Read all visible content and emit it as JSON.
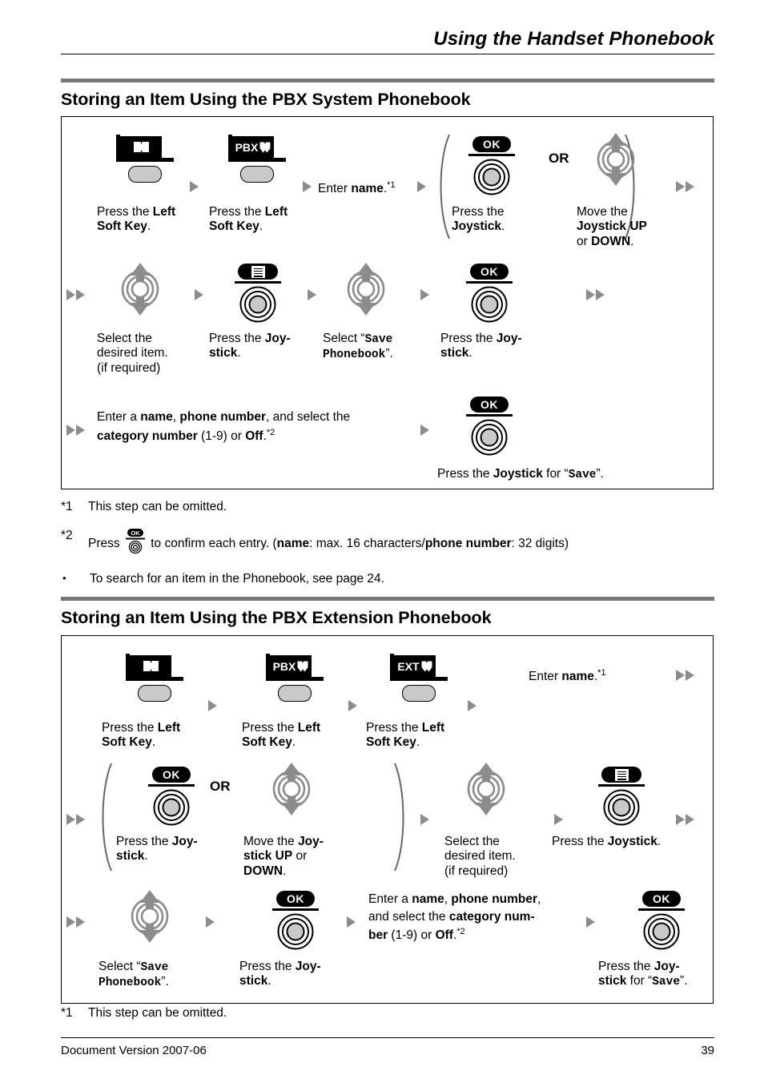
{
  "header": {
    "title": "Using the Handset Phonebook"
  },
  "section1": {
    "heading": "Storing an Item Using the PBX System Phonebook",
    "row1": {
      "step1": {
        "icon": "phonebook-softkey-icon",
        "badge": "",
        "caption_pre": "Press the ",
        "caption_bold": "Left Soft Key",
        "caption_post": "."
      },
      "step2": {
        "icon": "pbx-softkey-icon",
        "badge": "PBX",
        "caption_pre": "Press the ",
        "caption_bold": "Left Soft Key",
        "caption_post": "."
      },
      "step3": {
        "text_pre": "Enter ",
        "text_bold": "name",
        "text_post": ".",
        "footnote": "*1"
      },
      "step4": {
        "icon": "joystick-ok-icon",
        "label": "OK",
        "caption_pre": "Press the ",
        "caption_bold": "Joystick",
        "caption_post": "."
      },
      "or_label": "OR",
      "step5": {
        "icon": "joystick-updown-icon",
        "caption_l1_pre": "Move the ",
        "caption_l1_bold": "Joystick UP",
        "caption_l2_pre": "or ",
        "caption_l2_bold": "DOWN",
        "caption_l2_post": "."
      }
    },
    "row2": {
      "step6": {
        "icon": "joystick-updown-icon",
        "caption_l1": "Select the",
        "caption_l2": "desired item.",
        "caption_l3": "(if required)"
      },
      "step7": {
        "icon": "joystick-menu-icon",
        "label": "menu-glyph",
        "caption_pre": "Press the ",
        "caption_bold": "Joy-stick",
        "caption_post": "."
      },
      "step8": {
        "icon": "joystick-updown-icon",
        "caption_pre": "Select “",
        "caption_mono": "Save Phonebook",
        "caption_post": "”."
      },
      "step9": {
        "icon": "joystick-ok-icon",
        "label": "OK",
        "caption_pre": "Press the ",
        "caption_bold": "Joy-stick",
        "caption_post": "."
      }
    },
    "row3": {
      "step10": {
        "l1_pre": "Enter a ",
        "l1_b1": "name",
        "l1_mid": ", ",
        "l1_b2": "phone number",
        "l1_post": ", and select the",
        "l2_b1": "category number",
        "l2_mid": " (1-9) or ",
        "l2_b2": "Off",
        "l2_post": ".",
        "footnote": "*2"
      },
      "step11": {
        "icon": "joystick-ok-icon",
        "label": "OK",
        "caption_pre": "Press the ",
        "caption_bold": "Joystick",
        "caption_mid": " for “",
        "caption_mono": "Save",
        "caption_post": "”."
      }
    },
    "footnotes": [
      {
        "mark": "*1",
        "text": "This step can be omitted."
      },
      {
        "mark": "*2",
        "pre": "Press ",
        "icon": "joystick-ok-small-icon",
        "mid": " to confirm each entry. (",
        "b1": "name",
        "mid2": ": max. 16 characters/",
        "b2": "phone number",
        "post": ": 32 digits)"
      },
      {
        "mark": "•",
        "text": "To search for an item in the Phonebook, see page 24."
      }
    ]
  },
  "section2": {
    "heading": "Storing an Item Using the PBX Extension Phonebook",
    "row1": {
      "step1": {
        "icon": "phonebook-softkey-icon",
        "badge": "",
        "caption_pre": "Press the ",
        "caption_bold": "Left Soft Key",
        "caption_post": "."
      },
      "step2": {
        "icon": "pbx-softkey-icon",
        "badge": "PBX",
        "caption_pre": "Press the ",
        "caption_bold": "Left Soft Key",
        "caption_post": "."
      },
      "step3": {
        "icon": "ext-softkey-icon",
        "badge": "EXT",
        "caption_pre": "Press the ",
        "caption_bold": "Left Soft Key",
        "caption_post": "."
      },
      "step4": {
        "text_pre": "Enter ",
        "text_bold": "name",
        "text_post": ".",
        "footnote": "*1"
      }
    },
    "row2": {
      "step5": {
        "icon": "joystick-ok-icon",
        "label": "OK",
        "caption_pre": "Press the ",
        "caption_bold": "Joy-stick",
        "caption_post": "."
      },
      "or_label": "OR",
      "step6": {
        "icon": "joystick-updown-icon",
        "caption_l1_pre": "Move the ",
        "caption_l1_bold": "Joy-",
        "caption_l2_bold": "stick UP",
        "caption_l2_post": " or",
        "caption_l3_bold": "DOWN",
        "caption_l3_post": "."
      },
      "step7": {
        "icon": "joystick-updown-icon",
        "caption_l1": "Select the",
        "caption_l2": "desired item.",
        "caption_l3": "(if required)"
      },
      "step8": {
        "icon": "joystick-menu-icon",
        "caption_pre": "Press the ",
        "caption_bold": "Joystick",
        "caption_post": "."
      }
    },
    "row3": {
      "step9": {
        "icon": "joystick-updown-icon",
        "caption_pre": "Select “",
        "caption_mono": "Save Phonebook",
        "caption_post": "”."
      },
      "step10": {
        "icon": "joystick-ok-icon",
        "label": "OK",
        "caption_pre": "Press the ",
        "caption_bold": "Joy-stick",
        "caption_post": "."
      },
      "step11": {
        "l1_pre": "Enter a ",
        "l1_b1": "name",
        "l1_mid": ", ",
        "l1_b2": "phone number",
        "l1_post": ",",
        "l2_pre": "and select the ",
        "l2_b": "category num-",
        "l3_b1": "ber",
        "l3_mid": " (1-9) or ",
        "l3_b2": "Off",
        "l3_post": ".",
        "footnote": "*2"
      },
      "step12": {
        "icon": "joystick-ok-icon",
        "label": "OK",
        "caption_pre": "Press the ",
        "caption_bold": "Joy-",
        "caption_bold2": "stick",
        "caption_mid": " for “",
        "caption_mono": "Save",
        "caption_post": "”."
      }
    },
    "footnotes": [
      {
        "mark": "*1",
        "text": "This step can be omitted."
      }
    ]
  },
  "footer": {
    "doc_version": "Document Version  2007-06",
    "page_number": "39"
  },
  "colors": {
    "arrow_gray": "#8c8c8c",
    "bar_gray": "#777777",
    "button_gray": "#c9c9c9",
    "black": "#000000"
  }
}
